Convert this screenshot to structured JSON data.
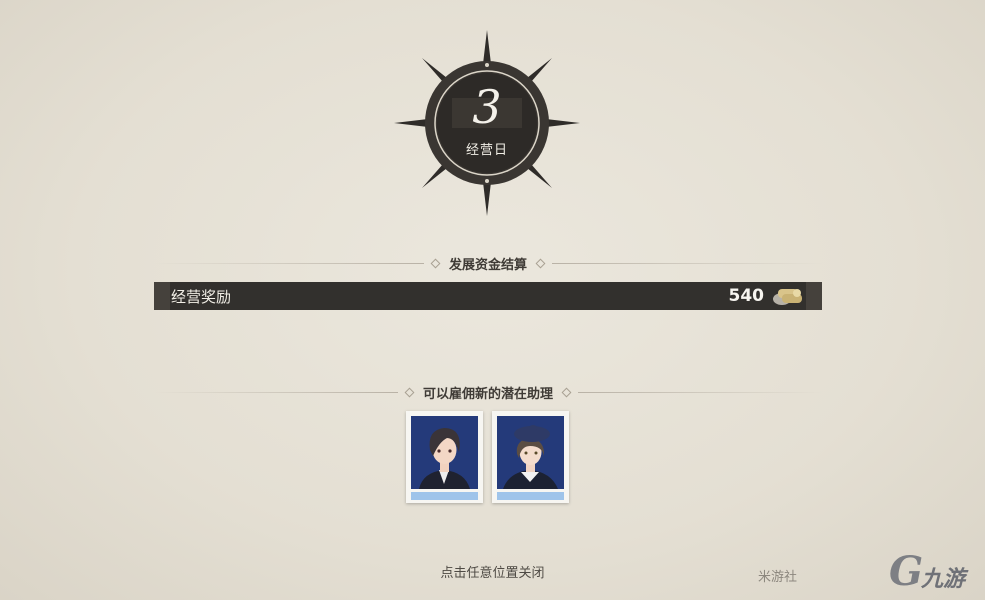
{
  "day": {
    "number": "3",
    "label": "经营日"
  },
  "funds": {
    "section_title": "发展资金结算",
    "reward_label": "经营奖励",
    "reward_value": "540",
    "icon": "coin-bundle-icon"
  },
  "assistants": {
    "section_title": "可以雇佣新的潜在助理",
    "cards": [
      {
        "portrait": "dark-haired-young-man-portrait"
      },
      {
        "portrait": "beret-wearing-assistant-portrait"
      }
    ]
  },
  "close_hint": "点击任意位置关闭",
  "watermark": {
    "text": "米游社",
    "logo_letter": "G",
    "logo_text": "九游"
  },
  "colors": {
    "bar": "#32302d",
    "background": "#e6e1d6",
    "card_stripe": "#9fc4ea",
    "portrait_bg": "#243a7a"
  }
}
